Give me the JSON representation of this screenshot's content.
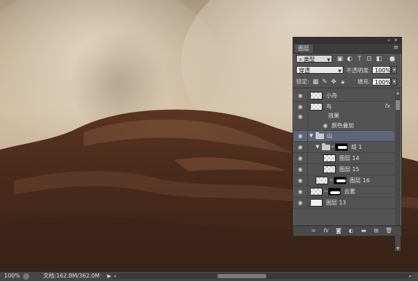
{
  "panel": {
    "tab_label": "图层",
    "menu_icon": "panel-menu-icon",
    "collapse_icon": "double-chevron-icon",
    "close_icon": "close-icon",
    "filter": {
      "kind_label": "类型",
      "icons": [
        "image-filter-icon",
        "adjustment-filter-icon",
        "type-filter-icon",
        "shape-filter-icon",
        "smart-object-filter-icon"
      ]
    },
    "blend_mode": "穿透",
    "opacity_label": "不透明度:",
    "opacity_value": "100%",
    "lock_label": "锁定:",
    "fill_label": "填充:",
    "fill_value": "100%",
    "layers": [
      {
        "name": "小舟",
        "visible": true
      },
      {
        "name": "鸟",
        "visible": true,
        "has_fx": true,
        "fx_label": "fx"
      },
      {
        "name": "效果",
        "visible": true,
        "is_effect_group": true
      },
      {
        "name": "颜色叠加",
        "visible": true,
        "is_effect": true
      },
      {
        "name": "山",
        "visible": true,
        "is_group": true,
        "selected": true
      },
      {
        "name": "组 1",
        "visible": true,
        "is_group": true
      },
      {
        "name": "图层 14",
        "visible": true
      },
      {
        "name": "图层 15",
        "visible": true
      },
      {
        "name": "图层 16",
        "visible": true
      },
      {
        "name": "云雾",
        "visible": true
      },
      {
        "name": "图层 13",
        "visible": true
      }
    ],
    "bottom_icons": [
      "link-layers-icon",
      "fx-icon",
      "layer-mask-icon",
      "adjustment-layer-icon",
      "new-group-icon",
      "new-layer-icon",
      "delete-icon"
    ]
  },
  "status": {
    "zoom": "100%",
    "doc_info": "文档:162.8M/362.0M",
    "arrow": "▶"
  }
}
